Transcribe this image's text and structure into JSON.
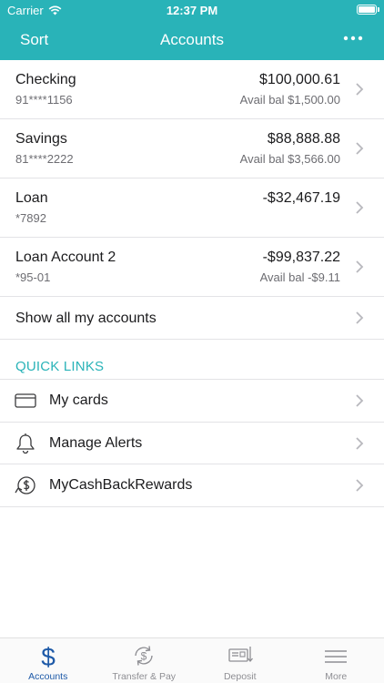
{
  "status_bar": {
    "carrier": "Carrier",
    "time": "12:37 PM"
  },
  "navbar": {
    "left_label": "Sort",
    "title": "Accounts",
    "more_icon": "more-icon"
  },
  "accounts": [
    {
      "name": "Checking",
      "number": "91****1156",
      "balance": "$100,000.61",
      "available": "Avail bal $1,500.00"
    },
    {
      "name": "Savings",
      "number": "81****2222",
      "balance": "$88,888.88",
      "available": "Avail bal $3,566.00"
    },
    {
      "name": "Loan",
      "number": "*7892",
      "balance": "-$32,467.19",
      "available": ""
    },
    {
      "name": "Loan Account 2",
      "number": "*95-01",
      "balance": "-$99,837.22",
      "available": "Avail bal -$9.11"
    }
  ],
  "show_all": {
    "label": "Show all my accounts"
  },
  "quick_links": {
    "header": "QUICK LINKS",
    "items": [
      {
        "label": "My cards",
        "icon": "card-icon"
      },
      {
        "label": "Manage Alerts",
        "icon": "bell-icon"
      },
      {
        "label": "MyCashBackRewards",
        "icon": "cashback-icon"
      }
    ]
  },
  "tabbar": {
    "tabs": [
      {
        "label": "Accounts",
        "icon": "dollar-icon",
        "active": true
      },
      {
        "label": "Transfer & Pay",
        "icon": "transfer-icon",
        "active": false
      },
      {
        "label": "Deposit",
        "icon": "deposit-icon",
        "active": false
      },
      {
        "label": "More",
        "icon": "menu-icon",
        "active": false
      }
    ]
  },
  "colors": {
    "brand": "#29b3b8",
    "active_tab": "#1e5aa8",
    "secondary_text": "#6d6d72"
  }
}
